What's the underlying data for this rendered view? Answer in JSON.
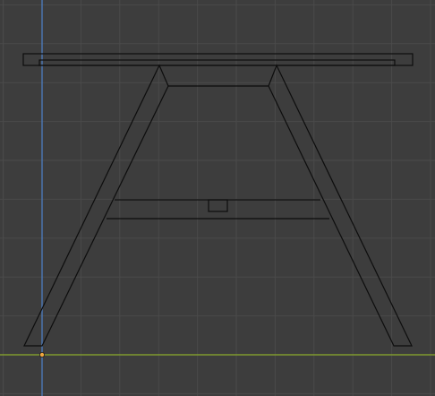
{
  "viewport": {
    "view": "front-orthographic",
    "background_color": "#3d3d3d",
    "grid_line_color": "#4a4a4a",
    "x_axis_color": "#7f9a2e",
    "z_axis_color": "#4c79b7",
    "object_outline_color": "#0d0d0d",
    "origin_marker_color": "#f0a63e",
    "object": {
      "name": "table-wireframe",
      "parts": [
        "tabletop",
        "left-leg",
        "right-leg",
        "crossbar",
        "center-block"
      ]
    }
  }
}
